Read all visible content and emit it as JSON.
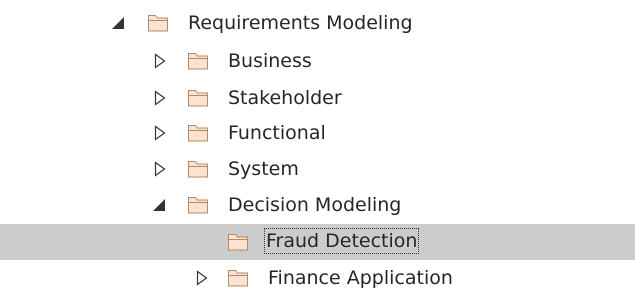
{
  "colors": {
    "selection": "#cccccc",
    "folder_fill": "#fbe3cf",
    "folder_stroke": "#b58a6a",
    "toggle": "#333333",
    "text": "#262626"
  },
  "tree": [
    {
      "label": "Requirements Modeling",
      "state": "expanded",
      "icon": "folder-icon"
    },
    {
      "label": "Business",
      "state": "collapsed",
      "icon": "folder-icon"
    },
    {
      "label": "Stakeholder",
      "state": "collapsed",
      "icon": "folder-icon"
    },
    {
      "label": "Functional",
      "state": "collapsed",
      "icon": "folder-icon"
    },
    {
      "label": "System",
      "state": "collapsed",
      "icon": "folder-icon"
    },
    {
      "label": "Decision Modeling",
      "state": "expanded",
      "icon": "folder-icon"
    },
    {
      "label": "Fraud Detection",
      "state": "leaf",
      "selected": true,
      "icon": "folder-icon"
    },
    {
      "label": "Finance Application",
      "state": "collapsed",
      "icon": "folder-icon"
    }
  ]
}
